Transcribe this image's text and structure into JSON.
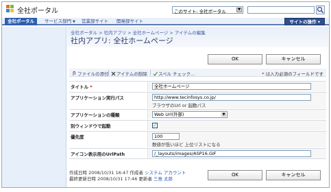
{
  "header": {
    "site_title": "全社ポータル",
    "scope_select_value": "このサイト: 全社ポータル",
    "search_value": ""
  },
  "tabs": [
    {
      "label": "全社ポータル",
      "active": true
    },
    {
      "label": "サービス部門",
      "dropdown": true
    },
    {
      "label": "営業部サイト"
    },
    {
      "label": "開発部サイト"
    }
  ],
  "site_actions_label": "サイトの操作 ▾",
  "breadcrumb": "全社ポータル > 社内アプリ > 全社ホームページ > アイテムの編集",
  "page_title": "社内アプリ: 全社ホームページ",
  "buttons": {
    "ok": "OK",
    "cancel": "キャンセル"
  },
  "toolbar": {
    "attach": "ファイルの添付",
    "delete": "アイテムの削除",
    "spell": "スペル チェック...",
    "required_note_star": "*",
    "required_note": "は入力必須のフィールドです"
  },
  "fields": {
    "title": {
      "label": "タイトル",
      "required": "*",
      "value": "全社ホームページ"
    },
    "url": {
      "label": "アプリケーション実行パス",
      "value": "http://www.tecinfosys.co.jp/",
      "hint": "ブラウザのUrl or 起動パス"
    },
    "type": {
      "label": "アプリケーションの種類",
      "value": "Web Url(外部)"
    },
    "new_window": {
      "label": "別ウィンドウで起動",
      "checked": true
    },
    "priority": {
      "label": "優先度",
      "value": "100",
      "hint": "数値が低いほど 上位リストになる"
    },
    "icon": {
      "label": "アイコン表示用のUrlPath",
      "value": "/_layouts/images/ASP16.GIF"
    }
  },
  "meta": {
    "created_prefix": "作成日時 2008/10/31 16:47  作成者",
    "created_by": "システム アカウント",
    "modified_prefix": "最終更新日時 2008/10/31 17:46  更新者",
    "modified_by": "三島 太郎"
  },
  "colors": {
    "accent": "#2d5fb0",
    "tab_bar_bg": "#eaf0f9",
    "left_nav_bg": "#e7effa",
    "required": "#cc0000",
    "link": "#2a56b0"
  }
}
